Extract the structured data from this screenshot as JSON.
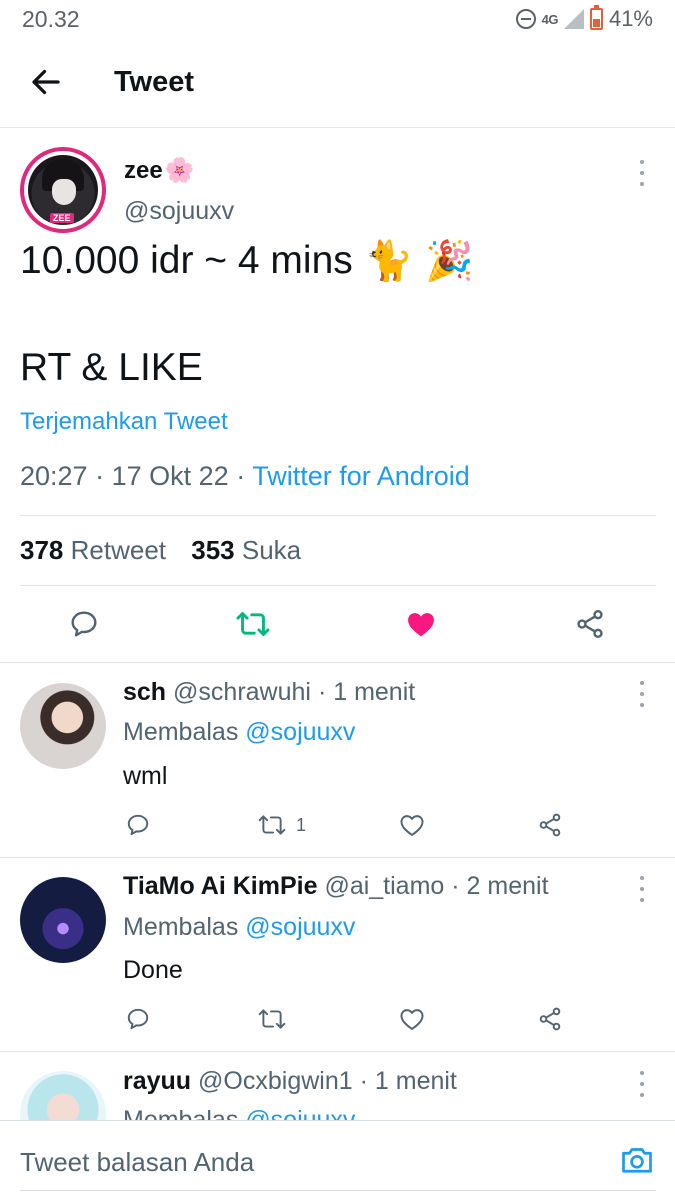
{
  "status_bar": {
    "time": "20.32",
    "network": "4G",
    "battery": "41%"
  },
  "header": {
    "title": "Tweet"
  },
  "tweet": {
    "name": "zee",
    "name_emoji": "🌸",
    "avatar_tag": "ZEE",
    "handle": "@sojuuxv",
    "text_line1": "10.000 idr ~ 4 mins",
    "emoji1": "🐈",
    "emoji2": "🎉",
    "text_line2": "RT & LIKE",
    "translate": "Terjemahkan Tweet",
    "time": "20:27",
    "date": "17 Okt 22",
    "source": "Twitter for Android",
    "retweets": "378",
    "retweets_label": "Retweet",
    "likes": "353",
    "likes_label": "Suka",
    "liked": true
  },
  "replies": [
    {
      "name": "sch",
      "handle": "@schrawuhi",
      "time": "1 menit",
      "reply_prefix": "Membalas",
      "reply_to": "@sojuuxv",
      "text": "wml",
      "retweets": "1"
    },
    {
      "name": "TiaMo Ai KimPie",
      "handle": "@ai_tiamo",
      "time": "2 menit",
      "reply_prefix": "Membalas",
      "reply_to": "@sojuuxv",
      "text": "Done",
      "retweets": ""
    },
    {
      "name": "rayuu",
      "handle": "@Ocxbigwin1",
      "time": "1 menit",
      "reply_prefix": "Membalas",
      "reply_to": "@sojuuxv"
    }
  ],
  "compose": {
    "placeholder": "Tweet balasan Anda"
  },
  "colors": {
    "accent": "#1d9bf0",
    "like": "#f91880",
    "retweet": "#00ba7c",
    "secondary_text": "#536471"
  }
}
